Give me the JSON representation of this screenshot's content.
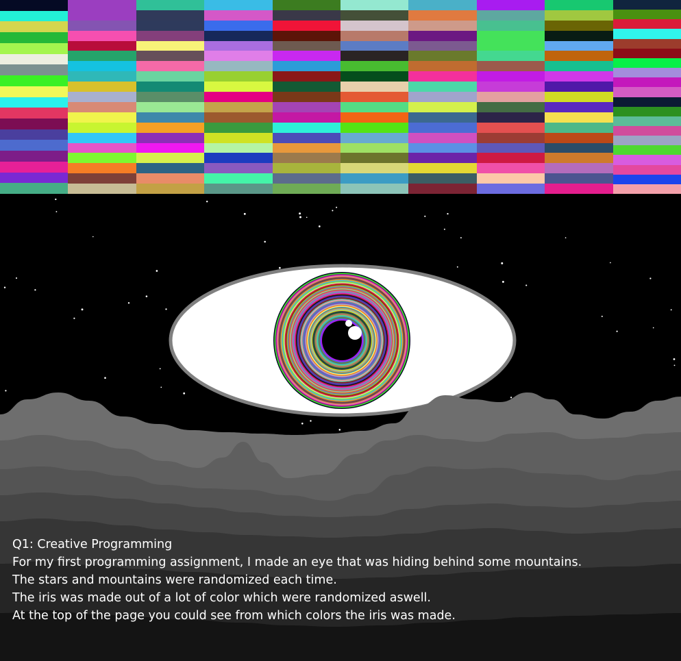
{
  "caption": {
    "title": "Q1: Creative Programming",
    "lines": [
      "For my first programming assignment, I made an eye that was hiding behind some mountains.",
      "The stars and mountains were randomized each time.",
      "The iris was made out of a lot of color which were randomized aswell.",
      "At the top of the page you could see from which colors the iris was made."
    ]
  },
  "palette": {
    "columns": [
      [
        "#050a24",
        "#23f0d6",
        "#d4d64e",
        "#25b838",
        "#a4f54e",
        "#eceee0",
        "#7b9190",
        "#3af025",
        "#f0f85a",
        "#2af0ec",
        "#e23662",
        "#7c0d53",
        "#4a3f9e",
        "#4d6bce",
        "#7d1d88",
        "#e62097",
        "#7929d3",
        "#45ad86"
      ],
      [
        "#9b3ec0",
        "#9b3ec0",
        "#8454b2",
        "#f54fb0",
        "#b80d3b",
        "#25a46b",
        "#15c2e0",
        "#2fb8b8",
        "#d8c12c",
        "#a8b0cf",
        "#d88a75",
        "#f0f44c",
        "#c8f530",
        "#33c7f5",
        "#e654c8",
        "#7ef830",
        "#f57d25",
        "#7e4038",
        "#c7bc95"
      ],
      [
        "#30c098",
        "#303a5a",
        "#2e3a5c",
        "#843f7b",
        "#f8f378",
        "#664f5a",
        "#f46aa8",
        "#6ad4a0",
        "#148a74",
        "#5a8e68",
        "#9ae894",
        "#3e88aa",
        "#f4a024",
        "#8c2eb6",
        "#f018f0",
        "#d6f04c",
        "#2c6484",
        "#e88c68",
        "#c3a145"
      ],
      [
        "#3abce6",
        "#d458c8",
        "#3a6cec",
        "#16285a",
        "#aa6ee0",
        "#e07ee8",
        "#96b8c0",
        "#98d030",
        "#d8f840",
        "#e40082",
        "#c4a44a",
        "#9c5a2e",
        "#3a9a3e",
        "#cfe224",
        "#b4f4a4",
        "#1d3cbf",
        "#8a5abf",
        "#44f4a8",
        "#5a9888"
      ],
      [
        "#3c7c20",
        "#3a3848",
        "#f01438",
        "#5c1408",
        "#6e5a50",
        "#c828f0",
        "#2c9cd8",
        "#8a1818",
        "#135a34",
        "#7a3818",
        "#a444b4",
        "#c418a4",
        "#2ef0d8",
        "#4c4cb8",
        "#e8983c",
        "#9c7a4c",
        "#a8b43c",
        "#5c6c8c",
        "#6fab56"
      ],
      [
        "#94e8d0",
        "#445038",
        "#d4c4cc",
        "#b87a6a",
        "#5c7cc4",
        "#2a2424",
        "#48bc30",
        "#044e1c",
        "#e8d0ac",
        "#e45a34",
        "#54dc84",
        "#f26414",
        "#54e414",
        "#68aad0",
        "#9ee064",
        "#6c742c",
        "#d8d878",
        "#3c9cc4",
        "#8cc4b8"
      ],
      [
        "#4ab0c8",
        "#e07a40",
        "#ce9a8a",
        "#6c1882",
        "#7c5a90",
        "#6a7a2c",
        "#c06c30",
        "#f4309c",
        "#4cd8a8",
        "#a0a4cc",
        "#d4f04c",
        "#3c6890",
        "#4c6cd4",
        "#d050c0",
        "#5c90e4",
        "#6c24a8",
        "#e4d834",
        "#3c5e64",
        "#7c2434"
      ],
      [
        "#a81cf0",
        "#5ea8a0",
        "#48c090",
        "#44e25a",
        "#44e25a",
        "#44d890",
        "#9c5a4c",
        "#c21ce4",
        "#c63cd8",
        "#e4a0a0",
        "#446c44",
        "#2c2448",
        "#e45050",
        "#9c3c34",
        "#5e58b8",
        "#ce1a42",
        "#f050a8",
        "#fcc8a8",
        "#6c6ce0"
      ],
      [
        "#18c870",
        "#a0c840",
        "#6a6404",
        "#081c14",
        "#60a8f0",
        "#c0640c",
        "#16c090",
        "#d038e8",
        "#5018a8",
        "#d0dc24",
        "#5a28c0",
        "#f4e050",
        "#4cb888",
        "#bc4818",
        "#2c4c68",
        "#ce7a2c",
        "#b46cbc",
        "#4c5490",
        "#e41e8e"
      ],
      [
        "#10243e",
        "#4a9010",
        "#da1c3a",
        "#30f4ec",
        "#9c3c2c",
        "#8c0c18",
        "#08f048",
        "#a48cdc",
        "#c418bc",
        "#d45cc4",
        "#0c1a34",
        "#2c9020",
        "#5cbc98",
        "#d04c9c",
        "#9ca4c4",
        "#4ed830",
        "#d85ce0",
        "#e448a0",
        "#1c44ec",
        "#f4a0aa"
      ]
    ]
  },
  "scene": {
    "colors": {
      "sky": "#000000",
      "star": "#ffffff",
      "sclera": "#ffffff",
      "sclera_outline": "#808080",
      "pupil": "#000000",
      "highlight": "#ffffff"
    },
    "mountain_layers": [
      {
        "name": "far-range",
        "color": "#6e6e6e"
      },
      {
        "name": "peak-range",
        "color": "#5f5f5f"
      },
      {
        "name": "mid-range",
        "color": "#545454"
      },
      {
        "name": "lower-range",
        "color": "#464646"
      },
      {
        "name": "near-range",
        "color": "#363636"
      },
      {
        "name": "front-range",
        "color": "#252525"
      },
      {
        "name": "foreground",
        "color": "#141414"
      }
    ]
  }
}
